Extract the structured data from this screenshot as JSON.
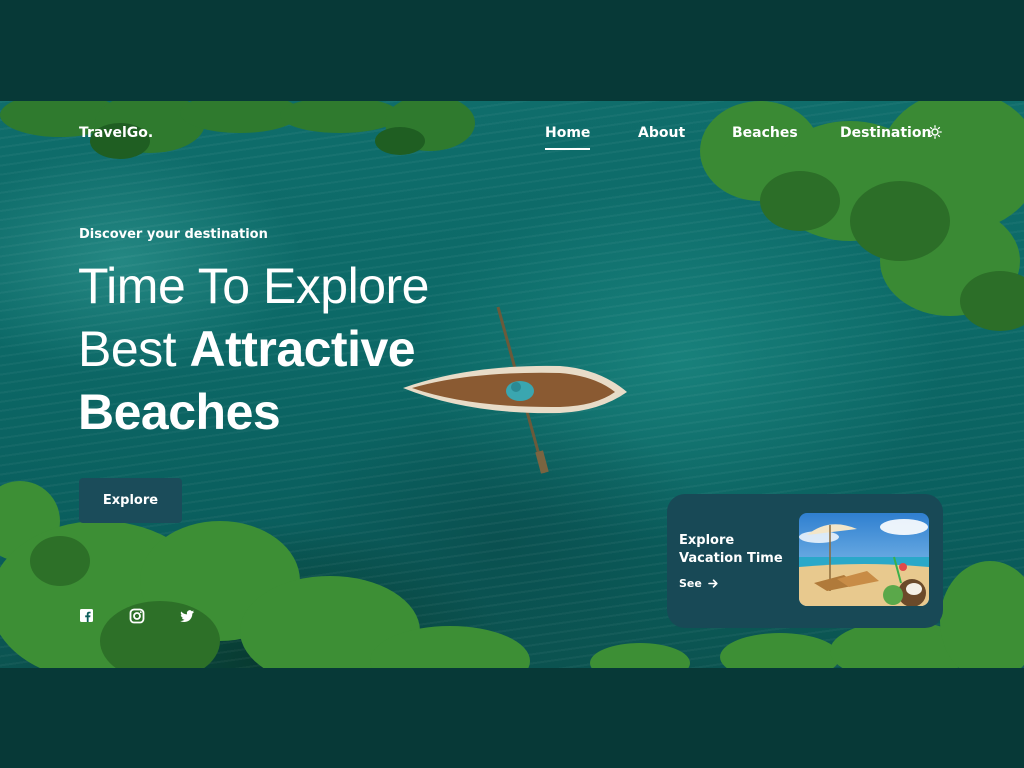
{
  "nav": {
    "logo": "TravelGo.",
    "links": [
      {
        "label": "Home",
        "active": true
      },
      {
        "label": "About",
        "active": false
      },
      {
        "label": "Beaches",
        "active": false
      },
      {
        "label": "Destination",
        "active": false
      }
    ],
    "theme_icon": "sun-icon"
  },
  "hero": {
    "subtitle": "Discover your destination",
    "headline": {
      "line1": "Time To Explore",
      "line2_regular": "Best ",
      "line2_bold": "Attractive",
      "line3_bold": "Beaches"
    },
    "cta_label": "Explore"
  },
  "social": {
    "icons": [
      "facebook-icon",
      "instagram-icon",
      "twitter-icon"
    ]
  },
  "card": {
    "title_line1": "Explore",
    "title_line2": "Vacation Time",
    "link_label": "See",
    "link_icon": "arrow-right-icon"
  },
  "colors": {
    "page_bg": "#073937",
    "water": "#0c6967",
    "button_bg": "#1b4c5a",
    "card_bg": "#184956"
  }
}
